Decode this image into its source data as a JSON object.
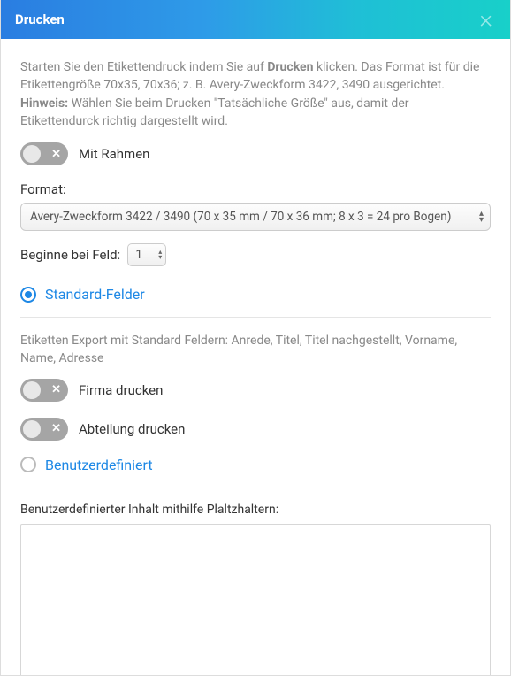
{
  "header": {
    "title": "Drucken"
  },
  "intro": {
    "pre": "Starten Sie den Etikettendruck indem Sie auf ",
    "bold1": "Drucken",
    "post1": " klicken. Das Format ist für die Etikettengröße 70x35, 70x36; z. B. Avery-Zweckform 3422, 3490 ausgerichtet.",
    "hint_bold": "Hinweis:",
    "hint_text": " Wählen Sie beim Drucken \"Tatsächliche Größe\" aus, damit der Etikettendurck richtig dargestellt wird."
  },
  "toggles": {
    "frame": "Mit Rahmen",
    "firm": "Firma drucken",
    "dept": "Abteilung drucken"
  },
  "format": {
    "label": "Format:",
    "selected": "Avery-Zweckform 3422 / 3490 (70 x 35 mm / 70 x 36 mm; 8 x 3 = 24 pro Bogen)"
  },
  "startField": {
    "label": "Beginne bei Feld:",
    "value": "1"
  },
  "radios": {
    "standard": "Standard-Felder",
    "custom": "Benutzerdefiniert"
  },
  "standardDesc": "Etiketten Export mit Standard Feldern: Anrede, Titel, Titel nachgestellt, Vorname, Name, Adresse",
  "customSection": {
    "label": "Benutzerdefinierter Inhalt mithilfe Plaltzhaltern:"
  }
}
